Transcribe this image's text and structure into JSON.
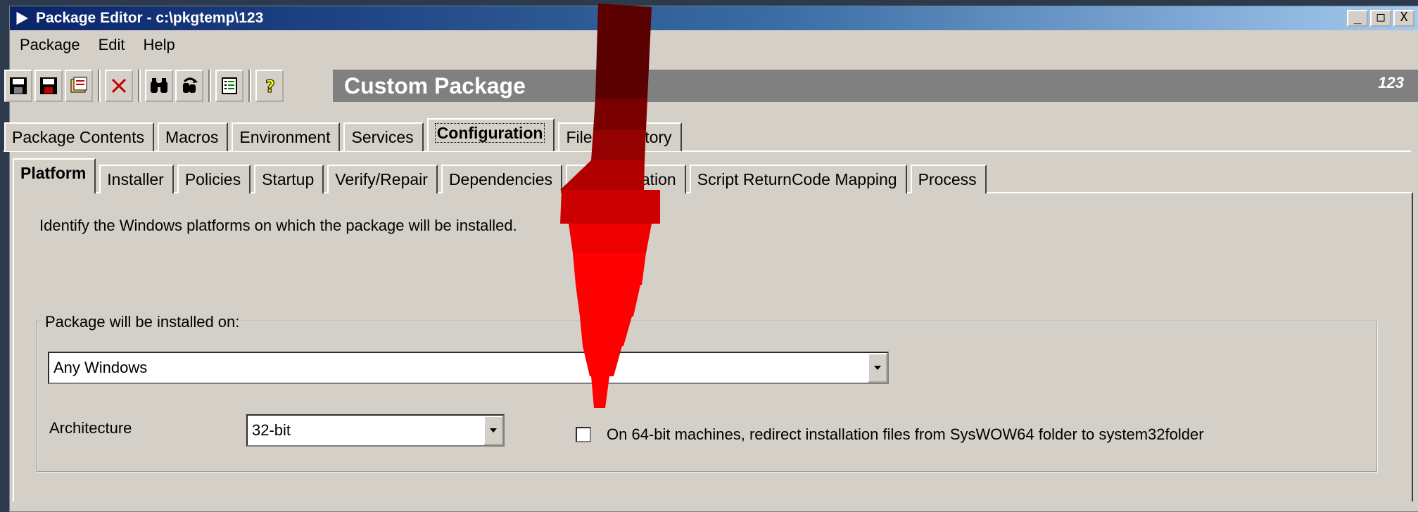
{
  "window": {
    "title": "Package Editor - c:\\pkgtemp\\123",
    "controls": [
      "_",
      "□",
      "X"
    ]
  },
  "menu": [
    "Package",
    "Edit",
    "Help"
  ],
  "toolbar": {
    "buttons": [
      "save-icon",
      "save-as-icon",
      "package-icon",
      "delete-icon",
      "find-icon",
      "find-replace-icon",
      "properties-icon",
      "help-icon"
    ],
    "banner_title": "Custom Package",
    "banner_right": "123"
  },
  "outer_tabs": [
    "Package Contents",
    "Macros",
    "Environment",
    "Services",
    "Configuration",
    "Files",
    "History"
  ],
  "outer_tabs_active": "Configuration",
  "inner_tabs": [
    "Platform",
    "Installer",
    "Policies",
    "Startup",
    "Verify/Repair",
    "Dependencies",
    "Customization",
    "Script ReturnCode Mapping",
    "Process"
  ],
  "inner_tabs_active": "Platform",
  "platform": {
    "description": "Identify the Windows platforms on which the package will be installed.",
    "group_label": "Package will be installed on:",
    "platform_value": "Any Windows",
    "architecture_label": "Architecture",
    "architecture_value": "32-bit",
    "redirect_checkbox_label": "On 64-bit machines, redirect installation files from SysWOW64 folder to system32folder",
    "redirect_checked": false
  },
  "annotation": {
    "arrow_color": "#ff0000"
  }
}
